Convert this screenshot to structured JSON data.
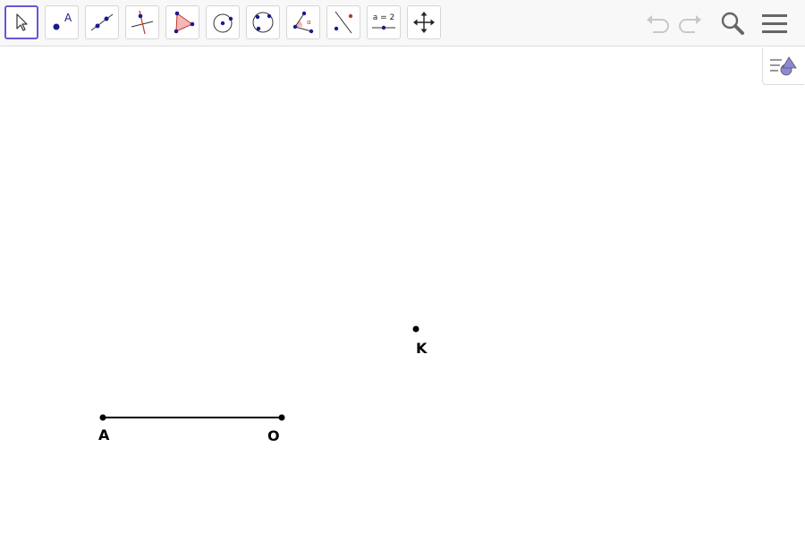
{
  "toolbar": {
    "tools": [
      {
        "name": "move-tool",
        "icon": "arrow-cursor-icon"
      },
      {
        "name": "point-tool",
        "icon": "point-icon",
        "glyph": "A"
      },
      {
        "name": "line-tool",
        "icon": "line-through-points-icon"
      },
      {
        "name": "perpendicular-line-tool",
        "icon": "perpendicular-line-icon"
      },
      {
        "name": "polygon-tool",
        "icon": "polygon-icon"
      },
      {
        "name": "circle-tool",
        "icon": "circle-center-point-icon"
      },
      {
        "name": "circle-three-points-tool",
        "icon": "circle-three-points-icon"
      },
      {
        "name": "angle-tool",
        "icon": "angle-icon",
        "glyph": "α"
      },
      {
        "name": "reflect-tool",
        "icon": "reflect-about-line-icon"
      },
      {
        "name": "slider-tool",
        "icon": "slider-icon",
        "glyph": "a = 2"
      },
      {
        "name": "move-graphics-tool",
        "icon": "move-graphics-view-icon"
      }
    ],
    "selected_tool": "move-tool",
    "undo_icon": "undo-icon",
    "redo_icon": "redo-icon",
    "search_icon": "search-icon",
    "menu_icon": "hamburger-menu-icon"
  },
  "algebra_toggle_icon": "algebra-view-icon",
  "graphics": {
    "points": [
      {
        "label": "A"
      },
      {
        "label": "O"
      },
      {
        "label": "K"
      }
    ],
    "segments": [
      {
        "from": "A",
        "to": "O"
      }
    ]
  },
  "colors": {
    "accent": "#6557d2",
    "point": "#1a1a8c",
    "polygon_fill": "#f4b8b8",
    "line_red": "#c0392b",
    "algebra_icon": "#8e88d9"
  }
}
